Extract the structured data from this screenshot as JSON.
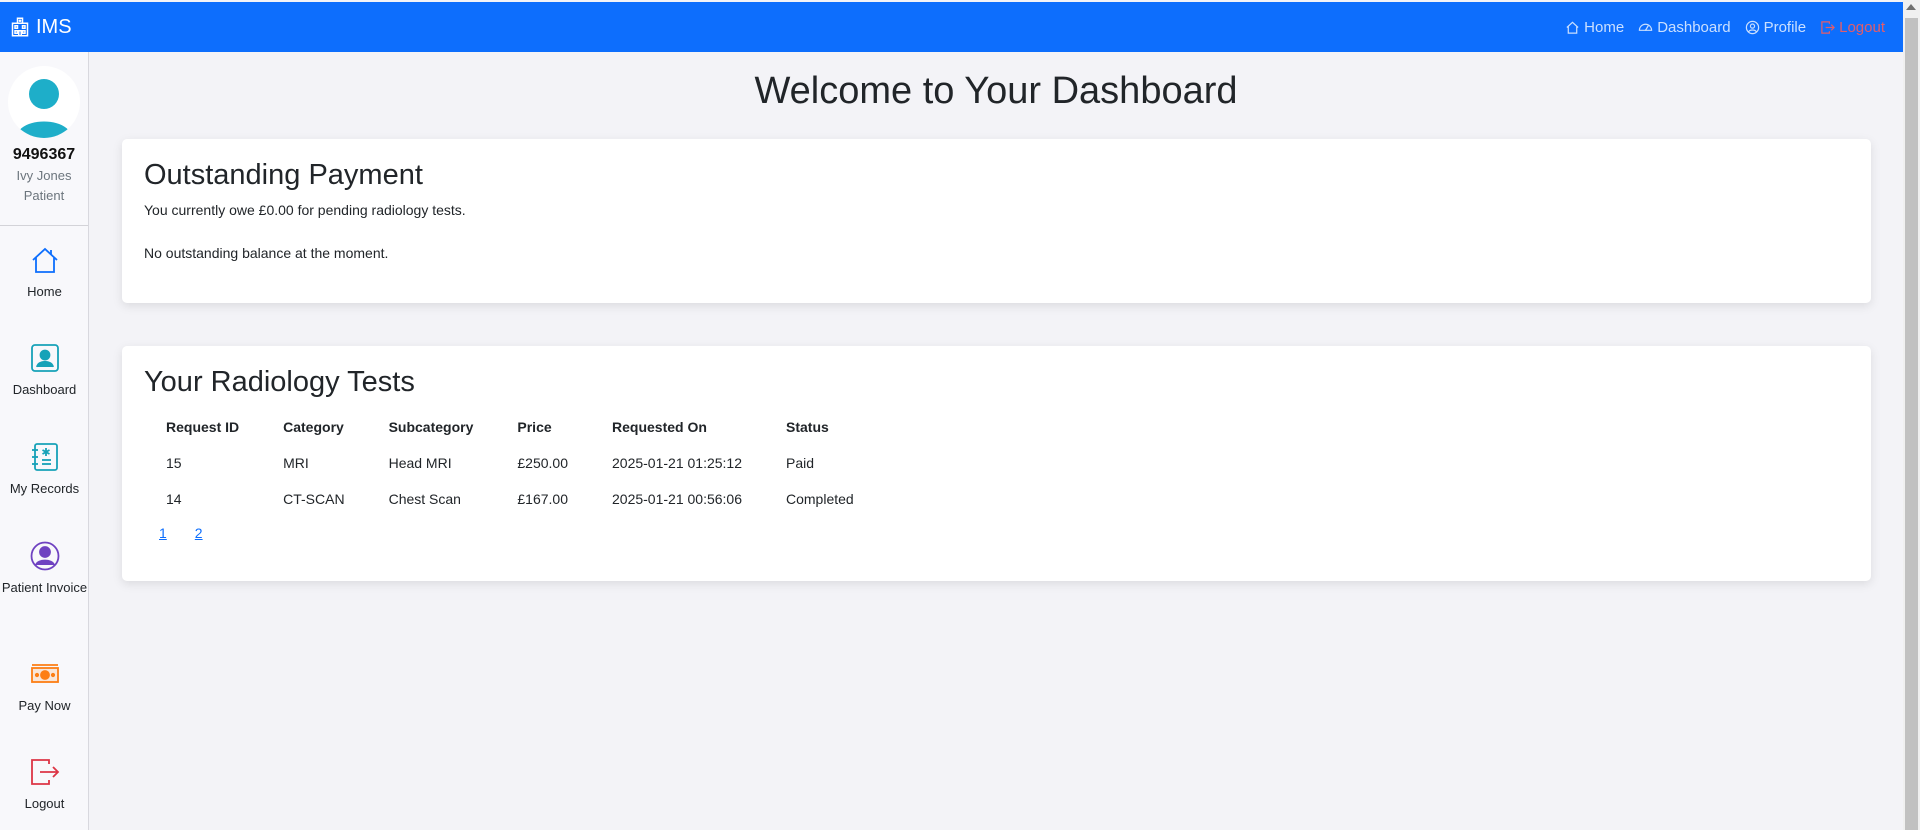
{
  "navbar": {
    "brand": "IMS",
    "links": [
      {
        "label": "Home",
        "icon": "house-icon"
      },
      {
        "label": "Dashboard",
        "icon": "speedometer-icon"
      },
      {
        "label": "Profile",
        "icon": "person-circle-icon"
      },
      {
        "label": "Logout",
        "icon": "logout-icon"
      }
    ]
  },
  "sidebar": {
    "patient_id": "9496367",
    "name": "Ivy Jones",
    "role": "Patient",
    "items": [
      {
        "label": "Home",
        "icon": "house-icon",
        "color": "#0d6efd"
      },
      {
        "label": "Dashboard",
        "icon": "person-badge-icon",
        "color": "#17a2b8"
      },
      {
        "label": "My Records",
        "icon": "journal-medical-icon",
        "color": "#17a2b8"
      },
      {
        "label": "Patient Invoice",
        "icon": "person-circle-icon",
        "color": "#6f42c1"
      },
      {
        "label": "Pay Now",
        "icon": "cash-icon",
        "color": "#fd7e14"
      },
      {
        "label": "Logout",
        "icon": "logout-icon",
        "color": "#dc3545"
      }
    ]
  },
  "main": {
    "title": "Welcome to Your Dashboard",
    "outstanding": {
      "heading": "Outstanding Payment",
      "owe_text": "You currently owe £0.00 for pending radiology tests.",
      "balance_text": "No outstanding balance at the moment."
    },
    "tests": {
      "heading": "Your Radiology Tests",
      "columns": [
        "Request ID",
        "Category",
        "Subcategory",
        "Price",
        "Requested On",
        "Status"
      ],
      "rows": [
        [
          "15",
          "MRI",
          "Head MRI",
          "£250.00",
          "2025-01-21 01:25:12",
          "Paid"
        ],
        [
          "14",
          "CT-SCAN",
          "Chest Scan",
          "£167.00",
          "2025-01-21 00:56:06",
          "Completed"
        ]
      ],
      "pages": [
        "1",
        "2"
      ]
    }
  },
  "colors": {
    "navbar": "#0d6efd",
    "logout": "#dc3545"
  }
}
